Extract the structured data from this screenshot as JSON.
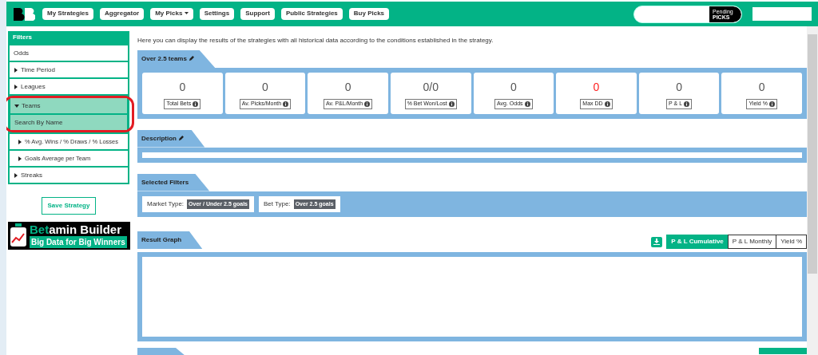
{
  "nav": {
    "items": [
      {
        "label": "My Strategies",
        "kind": "link"
      },
      {
        "label": "Aggregator",
        "kind": "link"
      },
      {
        "label": "My Picks",
        "kind": "dropdown"
      },
      {
        "label": "Settings",
        "kind": "link"
      },
      {
        "label": "Support",
        "kind": "link"
      },
      {
        "label": "Public Strategies",
        "kind": "link"
      },
      {
        "label": "Buy Picks",
        "kind": "link"
      }
    ],
    "pending": {
      "top": "Pending",
      "bottom": "PICKS"
    }
  },
  "sidebar": {
    "title": "Filters",
    "items": [
      {
        "label": "Odds",
        "kind": "plain"
      },
      {
        "label": "Time Period",
        "kind": "group",
        "expanded": false
      },
      {
        "label": "Leagues",
        "kind": "group",
        "expanded": false
      },
      {
        "label": "Teams",
        "kind": "group",
        "expanded": true,
        "children": [
          {
            "label": "Search By Name",
            "kind": "plain",
            "selected": true
          },
          {
            "label": "% Avg. Wins / % Draws / % Losses",
            "kind": "group",
            "expanded": false,
            "selected": false
          },
          {
            "label": "Goals Average per Team",
            "kind": "group",
            "expanded": false,
            "selected": false
          }
        ]
      },
      {
        "label": "Streaks",
        "kind": "group",
        "expanded": false
      }
    ],
    "save_button": "Save Strategy",
    "logo": {
      "accent": "Bet",
      "name": "amin Builder",
      "tagline": "Big Data for Big Winners"
    }
  },
  "intro": "Here you can display the results of the strategies with all historical data according to the conditions established in the strategy.",
  "strategy": {
    "title": "Over 2.5 teams",
    "stats": [
      {
        "value": "0",
        "label": "Total Bets",
        "color": "#555555"
      },
      {
        "value": "0",
        "label": "Av. Picks/Month",
        "color": "#555555"
      },
      {
        "value": "0",
        "label": "Av. P&L/Month",
        "color": "#555555"
      },
      {
        "value": "0/0",
        "label": "% Bet Won/Lost",
        "color": "#555555"
      },
      {
        "value": "0",
        "label": "Avg. Odds",
        "color": "#555555"
      },
      {
        "value": "0",
        "label": "Max DD",
        "color": "#ff2020"
      },
      {
        "value": "0",
        "label": "P & L",
        "color": "#555555"
      },
      {
        "value": "0",
        "label": "Yield %",
        "color": "#555555"
      }
    ]
  },
  "description": {
    "title": "Description"
  },
  "selected_filters": {
    "title": "Selected Filters",
    "items": [
      {
        "label": "Market Type:",
        "value": "Over / Under 2.5 goals"
      },
      {
        "label": "Bet Type:",
        "value": "Over 2.5 goals"
      }
    ]
  },
  "result_graph": {
    "title": "Result Graph",
    "tabs": [
      {
        "label": "P & L Cumulative",
        "selected": true
      },
      {
        "label": "P & L Monthly",
        "selected": false
      },
      {
        "label": "Yield %",
        "selected": false
      }
    ]
  }
}
